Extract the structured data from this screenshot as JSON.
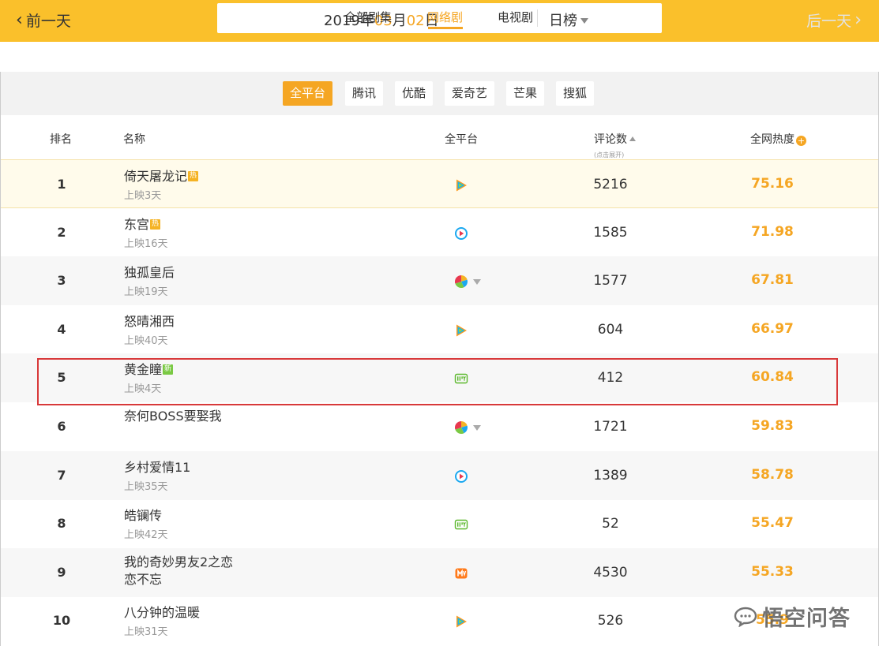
{
  "nav": {
    "prev_label": "前一天",
    "next_label": "后一天",
    "date": {
      "year": "2019",
      "year_unit": "年",
      "month": "03",
      "month_unit": "月",
      "day": "02",
      "day_unit": "日"
    },
    "ranking_period": "日榜"
  },
  "categories": [
    {
      "label": "全部剧集",
      "active": false
    },
    {
      "label": "网络剧",
      "active": true
    },
    {
      "label": "电视剧",
      "active": false
    }
  ],
  "platforms": [
    {
      "label": "全平台",
      "active": true
    },
    {
      "label": "腾讯",
      "active": false
    },
    {
      "label": "优酷",
      "active": false
    },
    {
      "label": "爱奇艺",
      "active": false
    },
    {
      "label": "芒果",
      "active": false
    },
    {
      "label": "搜狐",
      "active": false
    }
  ],
  "table": {
    "headers": {
      "rank": "排名",
      "name": "名称",
      "platform": "全平台",
      "comments": "评论数",
      "comments_hint": "(点击展开)",
      "heat": "全网热度"
    },
    "rows": [
      {
        "rank": "1",
        "title": "倚天屠龙记",
        "badge": "热",
        "days": "上映3天",
        "platform": "tencent-icon",
        "comments": "5216",
        "heat": "75.16"
      },
      {
        "rank": "2",
        "title": "东宫",
        "badge": "热",
        "days": "上映16天",
        "platform": "youku-icon",
        "comments": "1585",
        "heat": "71.98"
      },
      {
        "rank": "3",
        "title": "独孤皇后",
        "badge": "",
        "days": "上映19天",
        "platform": "multi-platform-icon",
        "comments": "1577",
        "heat": "67.81"
      },
      {
        "rank": "4",
        "title": "怒晴湘西",
        "badge": "",
        "days": "上映40天",
        "platform": "tencent-icon",
        "comments": "604",
        "heat": "66.97"
      },
      {
        "rank": "5",
        "title": "黄金瞳",
        "badge": "新",
        "days": "上映4天",
        "platform": "iqiyi-icon",
        "comments": "412",
        "heat": "60.84"
      },
      {
        "rank": "6",
        "title": "奈何BOSS要娶我",
        "badge": "",
        "days": "",
        "platform": "multi-platform-icon",
        "comments": "1721",
        "heat": "59.83"
      },
      {
        "rank": "7",
        "title": "乡村爱情11",
        "badge": "",
        "days": "上映35天",
        "platform": "youku-icon",
        "comments": "1389",
        "heat": "58.78"
      },
      {
        "rank": "8",
        "title": "皓镧传",
        "badge": "",
        "days": "上映42天",
        "platform": "iqiyi-icon",
        "comments": "52",
        "heat": "55.47"
      },
      {
        "rank": "9",
        "title": "我的奇妙男友2之恋恋不忘",
        "badge": "",
        "days": "",
        "platform": "mango-icon",
        "comments": "4530",
        "heat": "55.33"
      },
      {
        "rank": "10",
        "title": "八分钟的温暖",
        "badge": "",
        "days": "上映31天",
        "platform": "tencent-icon",
        "comments": "526",
        "heat": "55.9"
      }
    ]
  },
  "watermark": {
    "text": "悟空问答"
  },
  "colors": {
    "top_bar": "#fac02b",
    "accent": "#f5a623",
    "highlight_box": "#d8393a",
    "new_badge": "#7ac943"
  }
}
